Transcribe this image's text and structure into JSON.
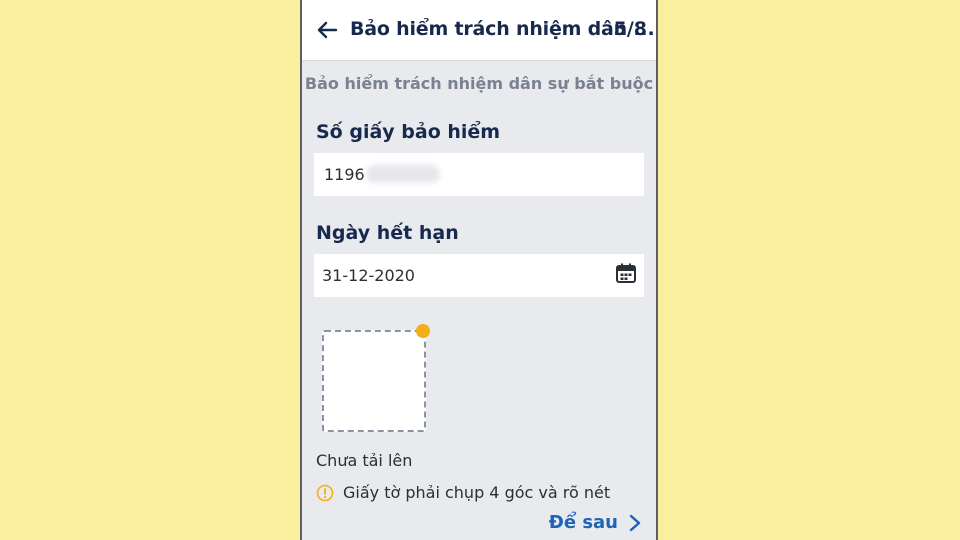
{
  "header": {
    "title": "Bảo hiểm trách nhiệm dân ...",
    "step": "5/8"
  },
  "section": {
    "subtitle": "Bảo hiểm trách nhiệm dân sự bắt buộc"
  },
  "fields": {
    "insurance_number": {
      "label": "Số giấy bảo hiểm",
      "value": "1196"
    },
    "expiry_date": {
      "label": "Ngày hết hạn",
      "value": "31-12-2020"
    }
  },
  "upload": {
    "status": "Chưa tải lên",
    "hint": "Giấy tờ phải chụp 4 góc và rõ nét"
  },
  "actions": {
    "later_label": "Để sau"
  },
  "colors": {
    "background": "#fbee9e",
    "title": "#17294d",
    "link": "#1d63b8",
    "warning": "#f2b017"
  },
  "icons": {
    "back": "arrow-left-icon",
    "calendar": "calendar-icon",
    "info": "info-circle-icon",
    "chevron": "chevron-right-icon"
  }
}
